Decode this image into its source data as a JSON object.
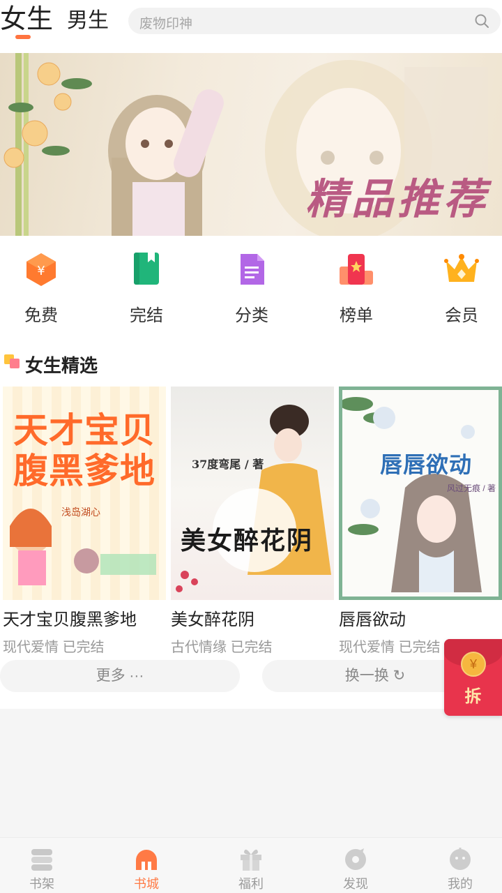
{
  "header": {
    "tabs": [
      {
        "label": "女生",
        "active": true
      },
      {
        "label": "男生",
        "active": false
      }
    ],
    "search_placeholder": "废物印神",
    "accent_color": "#ff7440"
  },
  "banner": {
    "title": "精品推荐"
  },
  "categories": [
    {
      "label": "免费",
      "icon": "free-coin-icon"
    },
    {
      "label": "完结",
      "icon": "finished-book-icon"
    },
    {
      "label": "分类",
      "icon": "category-document-icon"
    },
    {
      "label": "榜单",
      "icon": "ranking-icon"
    },
    {
      "label": "会员",
      "icon": "vip-crown-icon"
    }
  ],
  "section": {
    "title": "女生精选"
  },
  "books": [
    {
      "title": "天才宝贝腹黑爹地",
      "genre": "现代爱情",
      "status": "已完结",
      "cover_text": "天才宝贝腹黑爹地",
      "cover_author": "浅岛湖心"
    },
    {
      "title": "美女醉花阴",
      "genre": "古代情缘",
      "status": "已完结",
      "cover_text": "美女醉花阴",
      "cover_author": "37度弯尾 / 著"
    },
    {
      "title": "唇唇欲动",
      "genre": "现代爱情",
      "status": "已完结",
      "cover_text": "唇唇欲动",
      "cover_author": "风过无痕 / 著"
    }
  ],
  "actions": {
    "more_label": "更多 ···",
    "refresh_label": "换一换 ↻"
  },
  "red_packet": {
    "coin": "¥",
    "label": "拆"
  },
  "bottom_nav": [
    {
      "label": "书架",
      "icon": "bookshelf-icon",
      "active": false
    },
    {
      "label": "书城",
      "icon": "bookstore-icon",
      "active": true
    },
    {
      "label": "福利",
      "icon": "gift-icon",
      "active": false
    },
    {
      "label": "发现",
      "icon": "discover-icon",
      "active": false
    },
    {
      "label": "我的",
      "icon": "profile-icon",
      "active": false
    }
  ]
}
